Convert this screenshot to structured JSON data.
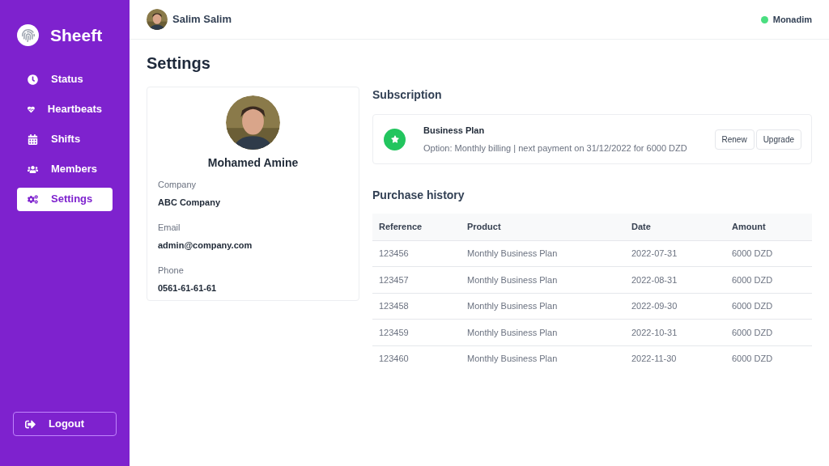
{
  "sidebar": {
    "brand": "Sheeft",
    "items": [
      {
        "label": "Status",
        "selected": false
      },
      {
        "label": "Heartbeats",
        "selected": false
      },
      {
        "label": "Shifts",
        "selected": false
      },
      {
        "label": "Members",
        "selected": false
      },
      {
        "label": "Settings",
        "selected": true
      }
    ],
    "logout": "Logout"
  },
  "header": {
    "user": "Salim Salim",
    "status": {
      "label": "Monadim",
      "online": true
    }
  },
  "title": "Settings",
  "profile": {
    "name": "Mohamed Amine",
    "fields": [
      {
        "label": "Company",
        "value": "ABC Company"
      },
      {
        "label": "Email",
        "value": "admin@company.com"
      },
      {
        "label": "Phone",
        "value": "0561-61-61-61"
      }
    ]
  },
  "subscription": {
    "heading": "Subscription",
    "plan": "Business Plan",
    "details": "Option: Monthly billing | next payment on 31/12/2022 for 6000 DZD",
    "buttons": [
      "Renew",
      "Upgrade"
    ]
  },
  "history": {
    "heading": "Purchase history",
    "columns": [
      "Reference",
      "Product",
      "Date",
      "Amount"
    ],
    "rows": [
      [
        "123456",
        "Monthly Business Plan",
        "2022-07-31",
        "6000 DZD"
      ],
      [
        "123457",
        "Monthly Business Plan",
        "2022-08-31",
        "6000 DZD"
      ],
      [
        "123458",
        "Monthly Business Plan",
        "2022-09-30",
        "6000 DZD"
      ],
      [
        "123459",
        "Monthly Business Plan",
        "2022-10-31",
        "6000 DZD"
      ],
      [
        "123460",
        "Monthly Business Plan",
        "2022-11-30",
        "6000 DZD"
      ]
    ]
  }
}
